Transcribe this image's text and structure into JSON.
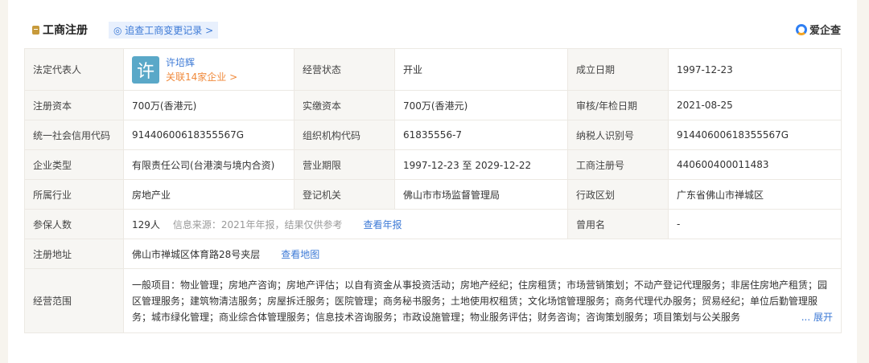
{
  "section": {
    "title": "工商注册",
    "trace_link": "◎ 追查工商变更记录 >",
    "brand": "爱企查"
  },
  "rows": {
    "legal_rep": {
      "label": "法定代表人",
      "avatar": "许",
      "name": "许培辉",
      "related": "关联14家企业 >"
    },
    "status": {
      "label": "经营状态",
      "value": "开业"
    },
    "founded": {
      "label": "成立日期",
      "value": "1997-12-23"
    },
    "reg_capital": {
      "label": "注册资本",
      "value": "700万(香港元)"
    },
    "paid_capital": {
      "label": "实缴资本",
      "value": "700万(香港元)"
    },
    "audit_date": {
      "label": "审核/年检日期",
      "value": "2021-08-25"
    },
    "credit_code": {
      "label": "统一社会信用代码",
      "value": "91440600618355567G"
    },
    "org_code": {
      "label": "组织机构代码",
      "value": "61835556-7"
    },
    "taxpayer_id": {
      "label": "纳税人识别号",
      "value": "91440600618355567G"
    },
    "company_type": {
      "label": "企业类型",
      "value": "有限责任公司(台港澳与境内合资)"
    },
    "term": {
      "label": "营业期限",
      "value": "1997-12-23 至 2029-12-22"
    },
    "reg_no": {
      "label": "工商注册号",
      "value": "440600400011483"
    },
    "industry": {
      "label": "所属行业",
      "value": "房地产业"
    },
    "authority": {
      "label": "登记机关",
      "value": "佛山市市场监督管理局"
    },
    "district": {
      "label": "行政区划",
      "value": "广东省佛山市禅城区"
    },
    "insured": {
      "label": "参保人数",
      "value": "129人",
      "source": "信息来源：2021年年报，结果仅供参考",
      "link": "查看年报"
    },
    "former_name": {
      "label": "曾用名",
      "value": "-"
    },
    "address": {
      "label": "注册地址",
      "value": "佛山市禅城区体育路28号夹层",
      "link": "查看地图"
    },
    "scope": {
      "label": "经营范围",
      "value": "一般项目：物业管理；房地产咨询；房地产评估；以自有资金从事投资活动；房地产经纪；住房租赁；市场营销策划；不动产登记代理服务；非居住房地产租赁；园区管理服务；建筑物清洁服务；房屋拆迁服务；医院管理；商务秘书服务；土地使用权租赁；文化场馆管理服务；商务代理代办服务；贸易经纪；单位后勤管理服务；城市绿化管理；商业综合体管理服务；信息技术咨询服务；市政设施管理；物业服务评估；财务咨询；咨询策划服务；项目策划与公关服务",
      "expand": "... 展开"
    }
  }
}
